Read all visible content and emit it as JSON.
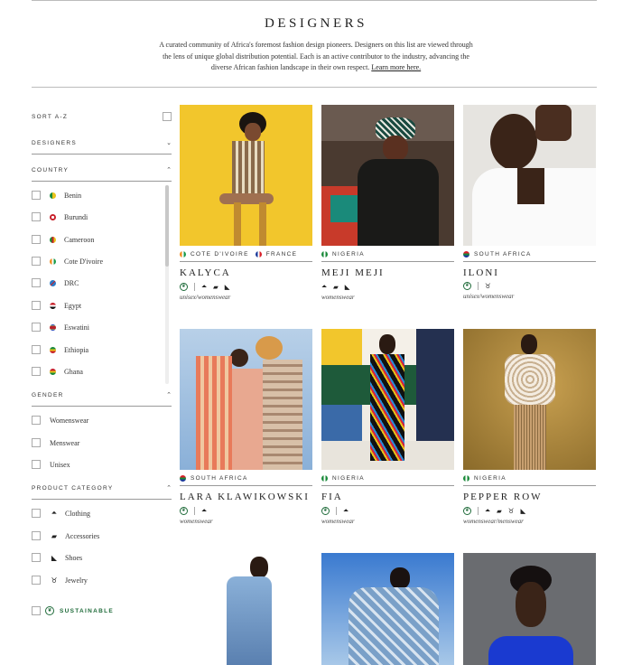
{
  "header": {
    "title": "DESIGNERS",
    "intro": "A curated community of Africa's foremost fashion design pioneers. Designers on this list are viewed through the lens of unique global distribution potential. Each is an active contributor to the industry, advancing the diverse African fashion landscape in their own respect.",
    "learn_more": "Learn more here."
  },
  "filters": {
    "sort_label": "SORT A-Z",
    "designers_label": "DESIGNERS",
    "country_label": "COUNTRY",
    "countries": [
      "Benin",
      "Burundi",
      "Cameroon",
      "Cote D'ivoire",
      "DRC",
      "Egypt",
      "Eswatini",
      "Ethiopia",
      "Ghana"
    ],
    "gender_label": "GENDER",
    "genders": [
      "Womenswear",
      "Menswear",
      "Unisex"
    ],
    "category_label": "PRODUCT CATEGORY",
    "categories": [
      {
        "label": "Clothing",
        "icon": "hanger-icon"
      },
      {
        "label": "Accessories",
        "icon": "bag-icon"
      },
      {
        "label": "Shoes",
        "icon": "heel-icon"
      },
      {
        "label": "Jewelry",
        "icon": "jewelry-icon"
      }
    ],
    "sustainable_label": "SUSTAINABLE"
  },
  "designers": [
    {
      "name": "KALYCA",
      "countries": [
        "COTE D'IVOIRE",
        "FRANCE"
      ],
      "tags": "unisex/womenswear",
      "icons": [
        "sustainable-icon",
        "hanger-icon",
        "bag-icon",
        "heel-icon"
      ]
    },
    {
      "name": "MEJI MEJI",
      "countries": [
        "NIGERIA"
      ],
      "tags": "womenswear",
      "icons": [
        "hanger-icon",
        "bag-icon",
        "heel-icon"
      ]
    },
    {
      "name": "ILONI",
      "countries": [
        "SOUTH AFRICA"
      ],
      "tags": "unisex/womenswear",
      "icons": [
        "sustainable-icon",
        "jewelry-icon"
      ]
    },
    {
      "name": "LARA KLAWIKOWSKI",
      "countries": [
        "SOUTH AFRICA"
      ],
      "tags": "womenswear",
      "icons": [
        "sustainable-icon",
        "hanger-icon"
      ]
    },
    {
      "name": "FIA",
      "countries": [
        "NIGERIA"
      ],
      "tags": "womenswear",
      "icons": [
        "sustainable-icon",
        "hanger-icon"
      ]
    },
    {
      "name": "PEPPER ROW",
      "countries": [
        "NIGERIA"
      ],
      "tags": "womenswear/menswear",
      "icons": [
        "sustainable-icon",
        "hanger-icon",
        "bag-icon",
        "jewelry-icon",
        "heel-icon"
      ]
    }
  ],
  "colors": {
    "accent_green": "#1f6b3a",
    "rule": "#999999"
  }
}
